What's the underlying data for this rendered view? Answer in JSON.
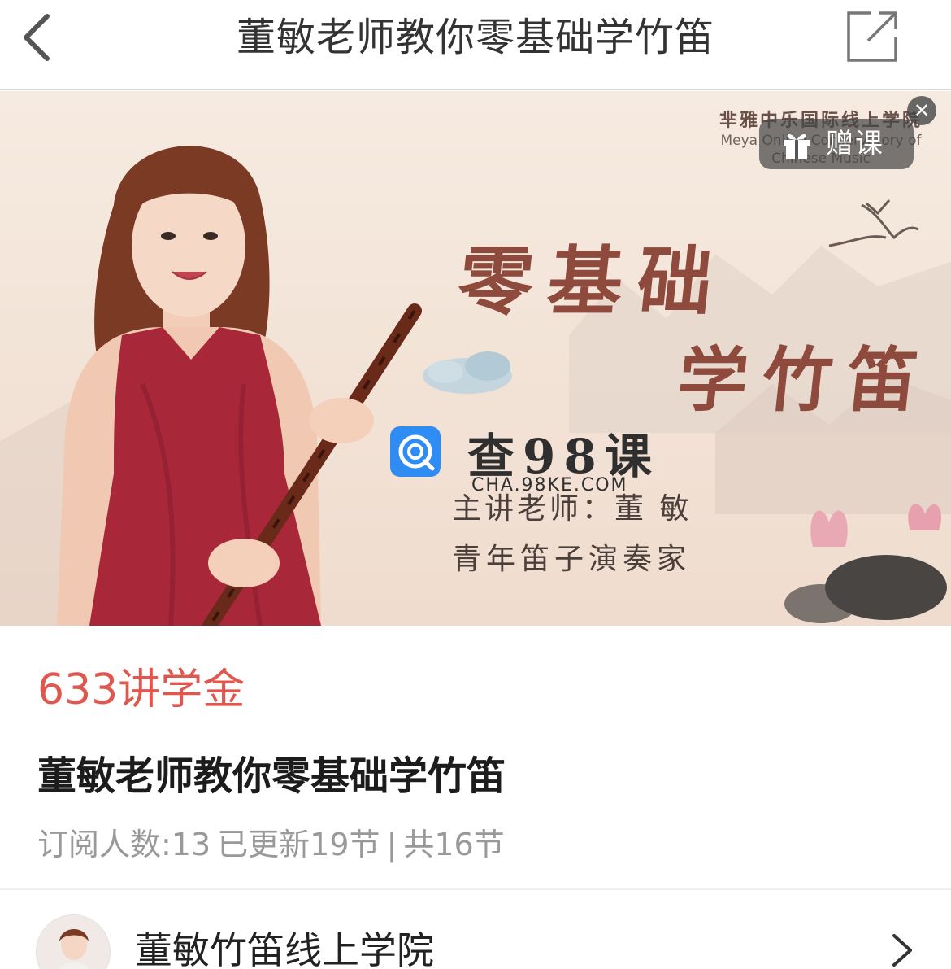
{
  "navbar": {
    "title": "董敏老师教你零基础学竹笛",
    "back_icon": "chevron-left-icon",
    "share_icon": "share-external-icon"
  },
  "banner": {
    "academy_cn": "芈雅中乐国际线上学院",
    "academy_en_line1": "Meya Online Conservatory of",
    "academy_en_line2": "Chinese Music",
    "headline_line1": "零基础",
    "headline_line2": "学竹笛",
    "teacher_line": "主讲老师：董 敏",
    "teacher_title": "青年笛子演奏家",
    "gift_label": "赠课",
    "close_symbol": "✕",
    "watermark_title": "查98课",
    "watermark_url": "CHA.98KE.COM"
  },
  "info": {
    "price": "633讲学金",
    "course_title": "董敏老师教你零基础学竹笛",
    "subscribers": "订阅人数:13",
    "updated": "已更新19节",
    "separator": "|",
    "total": "共16节"
  },
  "author": {
    "name": "董敏竹笛线上学院"
  },
  "colors": {
    "price": "#e0574f",
    "headline": "#8e4a3c",
    "meta": "#999999",
    "dress": "#a8283a"
  }
}
